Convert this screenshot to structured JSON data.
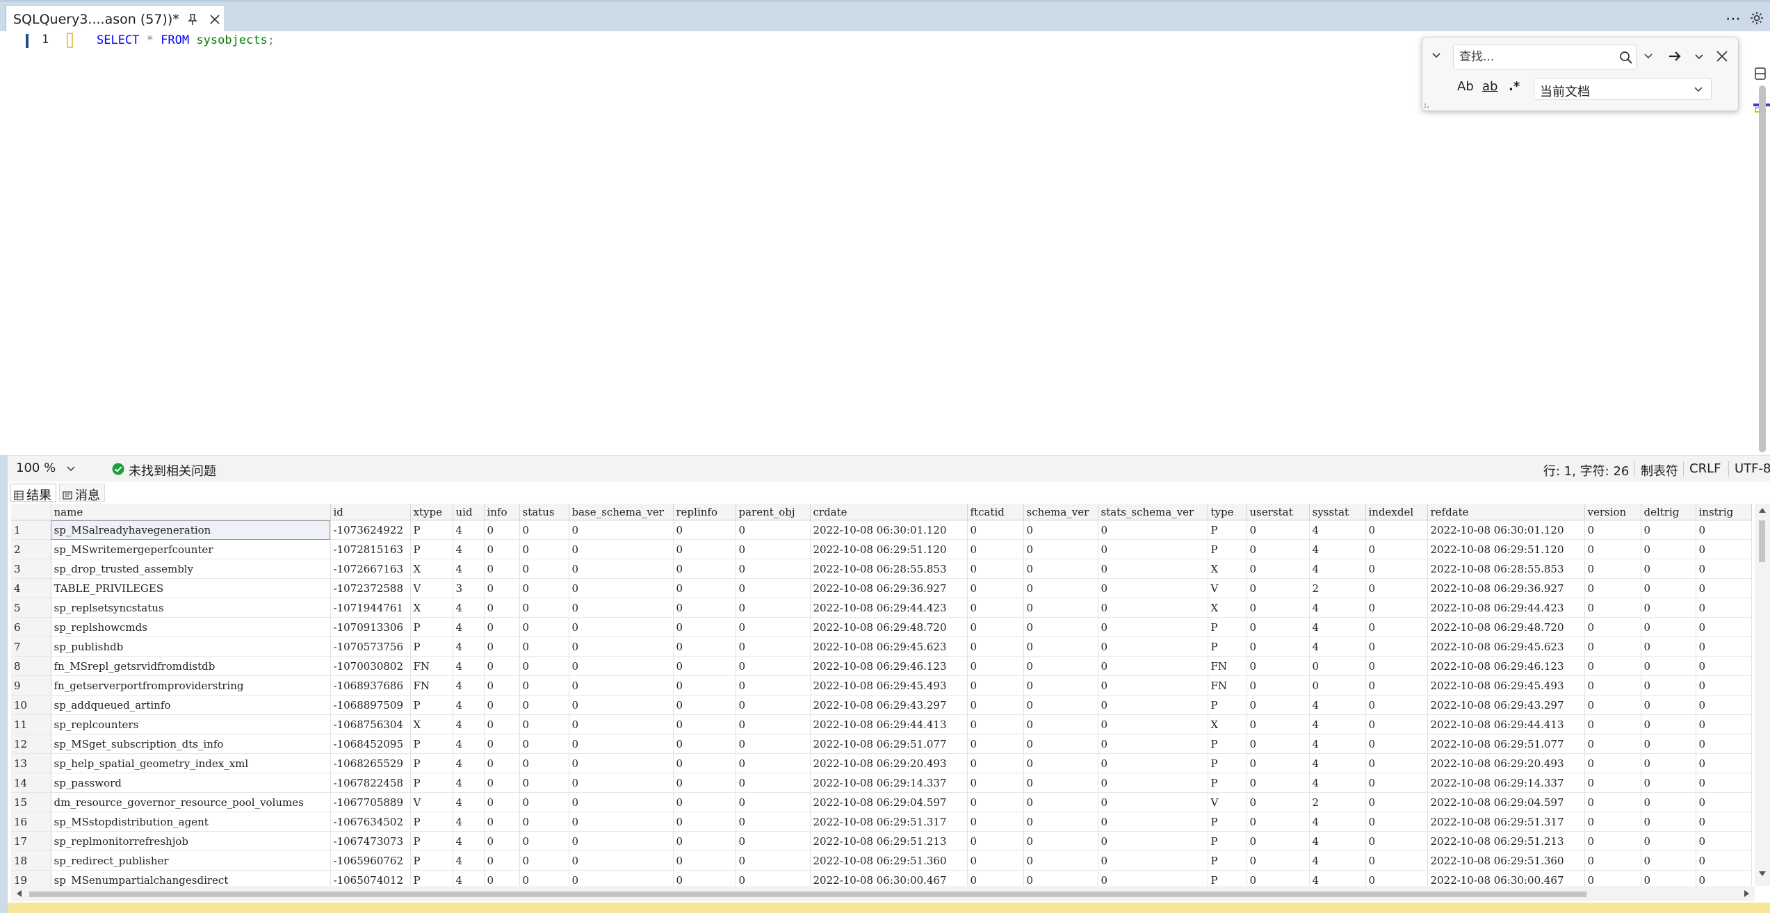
{
  "tab": {
    "title": "SQLQuery3....ason (57))*"
  },
  "editor": {
    "line_number": "1",
    "code": {
      "kw1": "SELECT",
      "star": "*",
      "kw2": "FROM",
      "object": "sysobjects",
      "semicolon": ";"
    }
  },
  "find": {
    "placeholder": "查找...",
    "match_case": "Ab",
    "whole_word": "ab",
    "regex": ".*",
    "scope": "当前文档"
  },
  "status": {
    "zoom": "100 %",
    "issues": "未找到相关问题",
    "position": "行: 1, 字符: 26",
    "indent": "制表符",
    "line_ending": "CRLF",
    "encoding": "UTF-8"
  },
  "results_tabs": {
    "results": "结果",
    "messages": "消息"
  },
  "grid": {
    "columns": [
      "name",
      "id",
      "xtype",
      "uid",
      "info",
      "status",
      "base_schema_ver",
      "replinfo",
      "parent_obj",
      "crdate",
      "ftcatid",
      "schema_ver",
      "stats_schema_ver",
      "type",
      "userstat",
      "sysstat",
      "indexdel",
      "refdate",
      "version",
      "deltrig",
      "instrig"
    ],
    "rows": [
      [
        "1",
        "sp_MSalreadyhavegeneration",
        "-1073624922",
        "P",
        "4",
        "0",
        "0",
        "0",
        "0",
        "0",
        "2022-10-08 06:30:01.120",
        "0",
        "0",
        "0",
        "P",
        "0",
        "4",
        "0",
        "2022-10-08 06:30:01.120",
        "0",
        "0",
        "0"
      ],
      [
        "2",
        "sp_MSwritemergeperfcounter",
        "-1072815163",
        "P",
        "4",
        "0",
        "0",
        "0",
        "0",
        "0",
        "2022-10-08 06:29:51.120",
        "0",
        "0",
        "0",
        "P",
        "0",
        "4",
        "0",
        "2022-10-08 06:29:51.120",
        "0",
        "0",
        "0"
      ],
      [
        "3",
        "sp_drop_trusted_assembly",
        "-1072667163",
        "X",
        "4",
        "0",
        "0",
        "0",
        "0",
        "0",
        "2022-10-08 06:28:55.853",
        "0",
        "0",
        "0",
        "X",
        "0",
        "4",
        "0",
        "2022-10-08 06:28:55.853",
        "0",
        "0",
        "0"
      ],
      [
        "4",
        "TABLE_PRIVILEGES",
        "-1072372588",
        "V",
        "3",
        "0",
        "0",
        "0",
        "0",
        "0",
        "2022-10-08 06:29:36.927",
        "0",
        "0",
        "0",
        "V",
        "0",
        "2",
        "0",
        "2022-10-08 06:29:36.927",
        "0",
        "0",
        "0"
      ],
      [
        "5",
        "sp_replsetsyncstatus",
        "-1071944761",
        "X",
        "4",
        "0",
        "0",
        "0",
        "0",
        "0",
        "2022-10-08 06:29:44.423",
        "0",
        "0",
        "0",
        "X",
        "0",
        "4",
        "0",
        "2022-10-08 06:29:44.423",
        "0",
        "0",
        "0"
      ],
      [
        "6",
        "sp_replshowcmds",
        "-1070913306",
        "P",
        "4",
        "0",
        "0",
        "0",
        "0",
        "0",
        "2022-10-08 06:29:48.720",
        "0",
        "0",
        "0",
        "P",
        "0",
        "4",
        "0",
        "2022-10-08 06:29:48.720",
        "0",
        "0",
        "0"
      ],
      [
        "7",
        "sp_publishdb",
        "-1070573756",
        "P",
        "4",
        "0",
        "0",
        "0",
        "0",
        "0",
        "2022-10-08 06:29:45.623",
        "0",
        "0",
        "0",
        "P",
        "0",
        "4",
        "0",
        "2022-10-08 06:29:45.623",
        "0",
        "0",
        "0"
      ],
      [
        "8",
        "fn_MSrepl_getsrvidfromdistdb",
        "-1070030802",
        "FN",
        "4",
        "0",
        "0",
        "0",
        "0",
        "0",
        "2022-10-08 06:29:46.123",
        "0",
        "0",
        "0",
        "FN",
        "0",
        "0",
        "0",
        "2022-10-08 06:29:46.123",
        "0",
        "0",
        "0"
      ],
      [
        "9",
        "fn_getserverportfromproviderstring",
        "-1068937686",
        "FN",
        "4",
        "0",
        "0",
        "0",
        "0",
        "0",
        "2022-10-08 06:29:45.493",
        "0",
        "0",
        "0",
        "FN",
        "0",
        "0",
        "0",
        "2022-10-08 06:29:45.493",
        "0",
        "0",
        "0"
      ],
      [
        "10",
        "sp_addqueued_artinfo",
        "-1068897509",
        "P",
        "4",
        "0",
        "0",
        "0",
        "0",
        "0",
        "2022-10-08 06:29:43.297",
        "0",
        "0",
        "0",
        "P",
        "0",
        "4",
        "0",
        "2022-10-08 06:29:43.297",
        "0",
        "0",
        "0"
      ],
      [
        "11",
        "sp_replcounters",
        "-1068756304",
        "X",
        "4",
        "0",
        "0",
        "0",
        "0",
        "0",
        "2022-10-08 06:29:44.413",
        "0",
        "0",
        "0",
        "X",
        "0",
        "4",
        "0",
        "2022-10-08 06:29:44.413",
        "0",
        "0",
        "0"
      ],
      [
        "12",
        "sp_MSget_subscription_dts_info",
        "-1068452095",
        "P",
        "4",
        "0",
        "0",
        "0",
        "0",
        "0",
        "2022-10-08 06:29:51.077",
        "0",
        "0",
        "0",
        "P",
        "0",
        "4",
        "0",
        "2022-10-08 06:29:51.077",
        "0",
        "0",
        "0"
      ],
      [
        "13",
        "sp_help_spatial_geometry_index_xml",
        "-1068265529",
        "P",
        "4",
        "0",
        "0",
        "0",
        "0",
        "0",
        "2022-10-08 06:29:20.493",
        "0",
        "0",
        "0",
        "P",
        "0",
        "4",
        "0",
        "2022-10-08 06:29:20.493",
        "0",
        "0",
        "0"
      ],
      [
        "14",
        "sp_password",
        "-1067822458",
        "P",
        "4",
        "0",
        "0",
        "0",
        "0",
        "0",
        "2022-10-08 06:29:14.337",
        "0",
        "0",
        "0",
        "P",
        "0",
        "4",
        "0",
        "2022-10-08 06:29:14.337",
        "0",
        "0",
        "0"
      ],
      [
        "15",
        "dm_resource_governor_resource_pool_volumes",
        "-1067705889",
        "V",
        "4",
        "0",
        "0",
        "0",
        "0",
        "0",
        "2022-10-08 06:29:04.597",
        "0",
        "0",
        "0",
        "V",
        "0",
        "2",
        "0",
        "2022-10-08 06:29:04.597",
        "0",
        "0",
        "0"
      ],
      [
        "16",
        "sp_MSstopdistribution_agent",
        "-1067634502",
        "P",
        "4",
        "0",
        "0",
        "0",
        "0",
        "0",
        "2022-10-08 06:29:51.317",
        "0",
        "0",
        "0",
        "P",
        "0",
        "4",
        "0",
        "2022-10-08 06:29:51.317",
        "0",
        "0",
        "0"
      ],
      [
        "17",
        "sp_replmonitorrefreshjob",
        "-1067473073",
        "P",
        "4",
        "0",
        "0",
        "0",
        "0",
        "0",
        "2022-10-08 06:29:51.213",
        "0",
        "0",
        "0",
        "P",
        "0",
        "4",
        "0",
        "2022-10-08 06:29:51.213",
        "0",
        "0",
        "0"
      ],
      [
        "18",
        "sp_redirect_publisher",
        "-1065960762",
        "P",
        "4",
        "0",
        "0",
        "0",
        "0",
        "0",
        "2022-10-08 06:29:51.360",
        "0",
        "0",
        "0",
        "P",
        "0",
        "4",
        "0",
        "2022-10-08 06:29:51.360",
        "0",
        "0",
        "0"
      ],
      [
        "19",
        "sp_MSenumpartialchangesdirect",
        "-1065074012",
        "P",
        "4",
        "0",
        "0",
        "0",
        "0",
        "0",
        "2022-10-08 06:30:00.467",
        "0",
        "0",
        "0",
        "P",
        "0",
        "4",
        "0",
        "2022-10-08 06:30:00.467",
        "0",
        "0",
        "0"
      ]
    ]
  },
  "colors": {
    "tab_bar": "#cddbe8",
    "keyword": "#0000ff",
    "object_name": "#008000",
    "status_ok": "#1a9e3e",
    "query_status_bar": "#f7e598"
  }
}
